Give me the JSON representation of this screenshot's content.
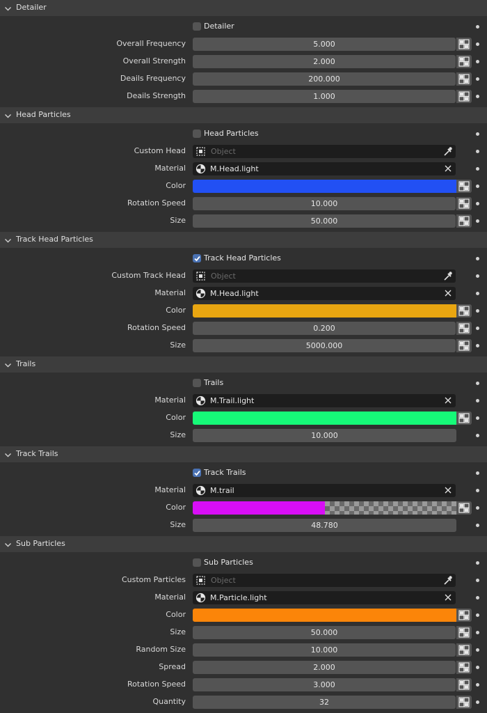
{
  "panels": [
    {
      "title": "Detailer",
      "rows": [
        {
          "type": "checkbox",
          "label": "Detailer",
          "checked": false
        },
        {
          "type": "number",
          "label": "Overall Frequency",
          "value": "5.000",
          "keyframe": true
        },
        {
          "type": "number",
          "label": "Overall Strength",
          "value": "2.000",
          "keyframe": true
        },
        {
          "type": "number",
          "label": "Deails Frequency",
          "value": "200.000",
          "keyframe": true
        },
        {
          "type": "number",
          "label": "Deails Strength",
          "value": "1.000",
          "keyframe": true
        }
      ]
    },
    {
      "title": "Head Particles",
      "rows": [
        {
          "type": "checkbox",
          "label": "Head Particles",
          "checked": false
        },
        {
          "type": "object",
          "label": "Custom Head",
          "placeholder": "Object"
        },
        {
          "type": "material",
          "label": "Material",
          "value": "M.Head.light"
        },
        {
          "type": "color",
          "label": "Color",
          "color": "#2250f4",
          "alpha": 1.0,
          "keyframe": true
        },
        {
          "type": "number",
          "label": "Rotation Speed",
          "value": "10.000",
          "keyframe": true
        },
        {
          "type": "number",
          "label": "Size",
          "value": "50.000",
          "keyframe": true
        }
      ]
    },
    {
      "title": "Track Head Particles",
      "rows": [
        {
          "type": "checkbox",
          "label": "Track Head Particles",
          "checked": true
        },
        {
          "type": "object",
          "label": "Custom Track Head",
          "placeholder": "Object"
        },
        {
          "type": "material",
          "label": "Material",
          "value": "M.Head.light"
        },
        {
          "type": "color",
          "label": "Color",
          "color": "#e9a611",
          "alpha": 1.0,
          "keyframe": true
        },
        {
          "type": "number",
          "label": "Rotation Speed",
          "value": "0.200",
          "keyframe": true
        },
        {
          "type": "number",
          "label": "Size",
          "value": "5000.000",
          "keyframe": true
        }
      ]
    },
    {
      "title": "Trails",
      "rows": [
        {
          "type": "checkbox",
          "label": "Trails",
          "checked": false
        },
        {
          "type": "material",
          "label": "Material",
          "value": "M.Trail.light"
        },
        {
          "type": "color",
          "label": "Color",
          "color": "#16fa78",
          "alpha": 1.0,
          "keyframe": true
        },
        {
          "type": "number",
          "label": "Size",
          "value": "10.000",
          "keyframe": false
        }
      ]
    },
    {
      "title": "Track Trails",
      "rows": [
        {
          "type": "checkbox",
          "label": "Track Trails",
          "checked": true
        },
        {
          "type": "material",
          "label": "Material",
          "value": "M.trail"
        },
        {
          "type": "color",
          "label": "Color",
          "color": "#d80ef6",
          "alpha": 0.5,
          "keyframe": true
        },
        {
          "type": "number",
          "label": "Size",
          "value": "48.780",
          "keyframe": false
        }
      ]
    },
    {
      "title": "Sub Particles",
      "rows": [
        {
          "type": "checkbox",
          "label": "Sub Particles",
          "checked": false
        },
        {
          "type": "object",
          "label": "Custom Particles",
          "placeholder": "Object"
        },
        {
          "type": "material",
          "label": "Material",
          "value": "M.Particle.light"
        },
        {
          "type": "color",
          "label": "Color",
          "color": "#fb8509",
          "alpha": 1.0,
          "keyframe": true
        },
        {
          "type": "number",
          "label": "Size",
          "value": "50.000",
          "keyframe": true
        },
        {
          "type": "number",
          "label": "Random Size",
          "value": "10.000",
          "keyframe": true
        },
        {
          "type": "number",
          "label": "Spread",
          "value": "2.000",
          "keyframe": true
        },
        {
          "type": "number",
          "label": "Rotation Speed",
          "value": "3.000",
          "keyframe": true
        },
        {
          "type": "number",
          "label": "Quantity",
          "value": "32",
          "keyframe": true
        }
      ]
    }
  ]
}
